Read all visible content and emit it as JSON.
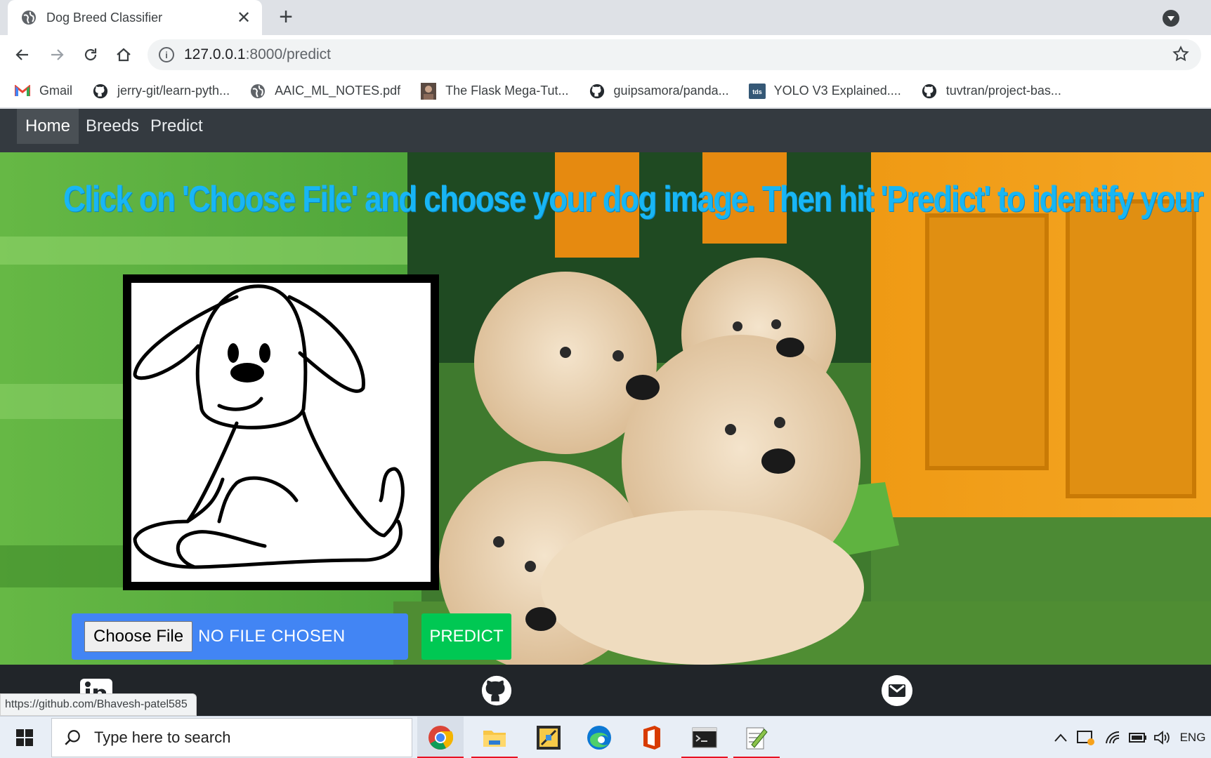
{
  "browser": {
    "tab_title": "Dog Breed Classifier",
    "new_tab_symbol": "+",
    "close_symbol": "✕",
    "url_host": "127.0.0.1",
    "url_path": ":8000/predict",
    "bookmarks": [
      {
        "label": "Gmail",
        "icon": "gmail-icon"
      },
      {
        "label": "jerry-git/learn-pyth...",
        "icon": "github-icon"
      },
      {
        "label": "AAIC_ML_NOTES.pdf",
        "icon": "globe-icon"
      },
      {
        "label": "The Flask Mega-Tut...",
        "icon": "avatar-icon"
      },
      {
        "label": "guipsamora/panda...",
        "icon": "github-icon"
      },
      {
        "label": "YOLO V3 Explained....",
        "icon": "tds-icon"
      },
      {
        "label": "tuvtran/project-bas...",
        "icon": "github-icon"
      }
    ],
    "tds_badge": "tds"
  },
  "site": {
    "nav": [
      "Home",
      "Breeds",
      "Predict"
    ],
    "headline": "Click on 'Choose File' and choose your dog image. Then hit 'Predict' to identify your Dog",
    "choose_file_label": "Choose File",
    "no_file_text": "NO FILE CHOSEN",
    "predict_label": "PREDICT",
    "status_url": "https://github.com/Bhavesh-patel585",
    "footer_icons": [
      "linkedin-icon",
      "github-icon",
      "gmail-icon"
    ]
  },
  "taskbar": {
    "search_placeholder": "Type here to search",
    "language": "ENG",
    "apps": [
      "chrome-icon",
      "file-explorer-icon",
      "sticky-app-icon",
      "edge-icon",
      "office-icon",
      "terminal-icon",
      "notepad-app-icon"
    ]
  },
  "colors": {
    "headline": "#18b6f4",
    "navbar": "#343a40",
    "form_bg": "#4285f4",
    "predict_bg": "#00c853"
  }
}
